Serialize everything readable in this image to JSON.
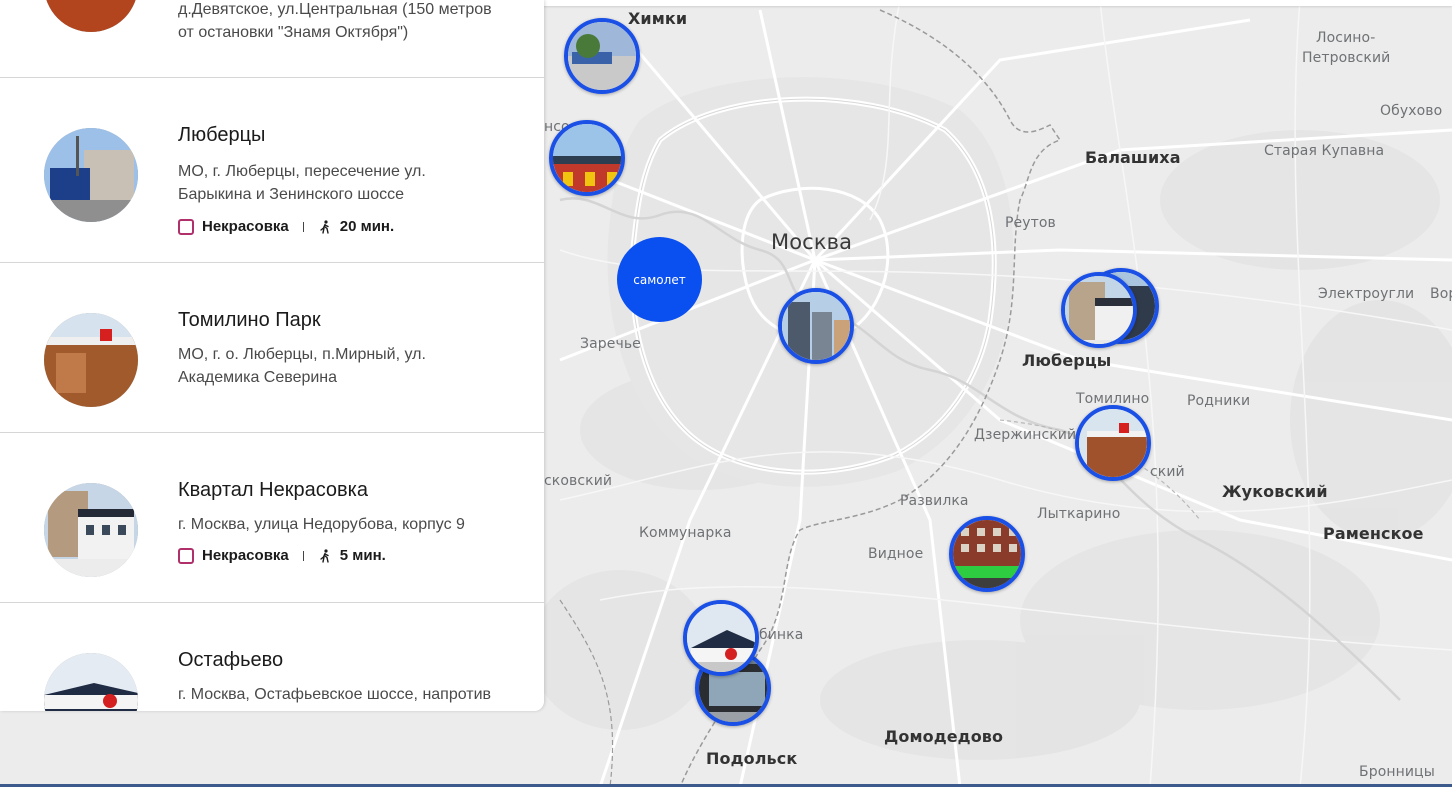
{
  "map": {
    "places": [
      {
        "name": "Химки",
        "type": "city"
      },
      {
        "name": "Лосино-",
        "type": "town"
      },
      {
        "name": "Петровский",
        "type": "town"
      },
      {
        "name": "Обухово",
        "type": "town"
      },
      {
        "name": "Балашиха",
        "type": "city"
      },
      {
        "name": "Старая Купавна",
        "type": "town"
      },
      {
        "name": "Реутов",
        "type": "town"
      },
      {
        "name": "Москва",
        "type": "capital"
      },
      {
        "name": "Электроугли",
        "type": "town"
      },
      {
        "name": "Вор",
        "type": "town"
      },
      {
        "name": "Заречье",
        "type": "town"
      },
      {
        "name": "Люберцы",
        "type": "city"
      },
      {
        "name": "Томилино",
        "type": "town"
      },
      {
        "name": "Родники",
        "type": "town"
      },
      {
        "name": "Дзержинский",
        "type": "town"
      },
      {
        "name": "ский",
        "type": "town"
      },
      {
        "name": "сковский",
        "type": "town"
      },
      {
        "name": "Жуковский",
        "type": "city"
      },
      {
        "name": "Развилка",
        "type": "town"
      },
      {
        "name": "Лыткарино",
        "type": "town"
      },
      {
        "name": "Раменское",
        "type": "city"
      },
      {
        "name": "Коммунарка",
        "type": "town"
      },
      {
        "name": "Видное",
        "type": "town"
      },
      {
        "name": "бинка",
        "type": "town"
      },
      {
        "name": "Домодедово",
        "type": "city"
      },
      {
        "name": "Подольск",
        "type": "city"
      },
      {
        "name": "Бронницы",
        "type": "town"
      },
      {
        "name": "нсо",
        "type": "town"
      }
    ],
    "cluster_label": "самолет",
    "colors": {
      "marker_border": "#1a50e6",
      "cluster_fill": "#0a4ff0",
      "metro_icon": "#b0306b"
    }
  },
  "panel": {
    "partial_top": {
      "address_lines": [
        "д.Девятское, ул.Центральная (150 метров",
        "от остановки \"Знамя Октября\")"
      ]
    },
    "items": [
      {
        "title": "Люберцы",
        "address_lines": [
          "МО, г. Люберцы, пересечение ул.",
          "Барыкина и Зенинского шоссе"
        ],
        "metro": "Некрасовка",
        "walk": "20 мин."
      },
      {
        "title": "Томилино Парк",
        "address_lines": [
          "МО, г. о. Люберцы, п.Мирный, ул.",
          "Академика Северина"
        ]
      },
      {
        "title": "Квартал Некрасовка",
        "address_lines": [
          "г. Москва, улица Недорубова, корпус 9"
        ],
        "metro": "Некрасовка",
        "walk": "5 мин."
      },
      {
        "title": "Остафьево",
        "address_lines": [
          "г. Москва, Остафьевское шоссе, напротив"
        ]
      }
    ]
  }
}
